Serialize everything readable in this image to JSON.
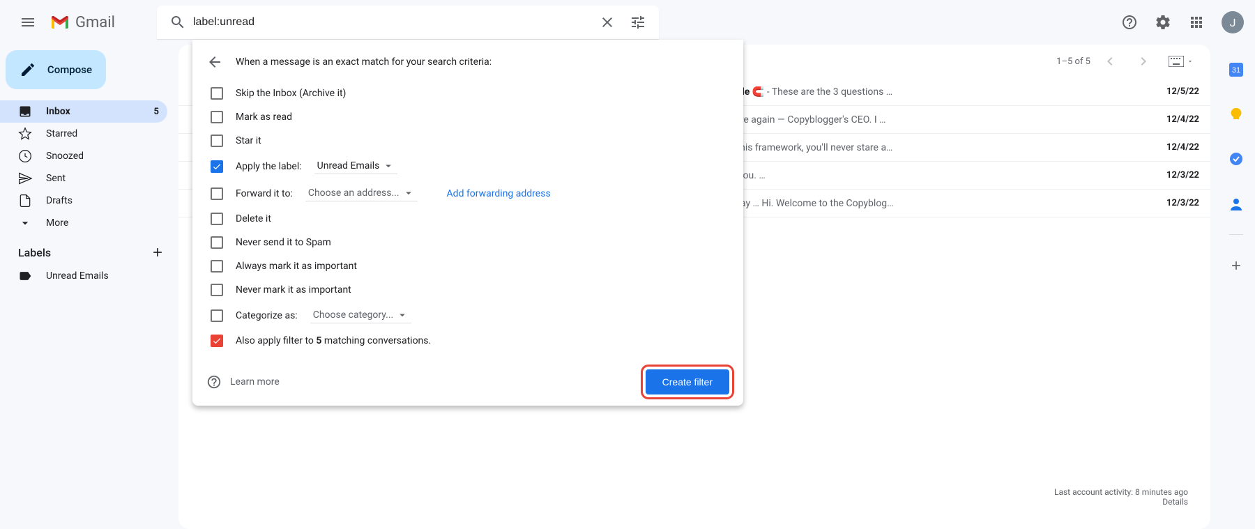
{
  "header": {
    "logo_text": "Gmail",
    "search_value": "label:unread",
    "avatar_letter": "J"
  },
  "sidebar": {
    "compose": "Compose",
    "items": [
      {
        "label": "Inbox",
        "count": "5"
      },
      {
        "label": "Starred"
      },
      {
        "label": "Snoozed"
      },
      {
        "label": "Sent"
      },
      {
        "label": "Drafts"
      },
      {
        "label": "More"
      }
    ],
    "labels_header": "Labels",
    "user_labels": [
      {
        "label": "Unread Emails"
      }
    ]
  },
  "toolbar": {
    "range": "1–5 of 5"
  },
  "messages": [
    {
      "subject": "rresistible",
      "emoji": "🧲",
      "snippet": " - These are the 3 questions …",
      "date": "12/5/22"
    },
    {
      "snippet": " - Tim here again — Copyblogger's CEO. I …",
      "date": "12/4/22"
    },
    {
      "snippet": " seeing this framework, you'll never stare a…",
      "date": "12/4/22"
    },
    {
      "snippet": "We got you.                                                             …",
      "date": "12/3/22"
    },
    {
      "snippet": "oice today … Hi. Welcome to the Copyblog…",
      "date": "12/3/22"
    }
  ],
  "footer": {
    "activity": "Last account activity: 8 minutes ago",
    "details": "Details"
  },
  "filter_popup": {
    "title": "When a message is an exact match for your search criteria:",
    "opts": {
      "skip_inbox": "Skip the Inbox (Archive it)",
      "mark_read": "Mark as read",
      "star_it": "Star it",
      "apply_label": "Apply the label:",
      "apply_label_value": "Unread Emails",
      "forward_to": "Forward it to:",
      "forward_placeholder": "Choose an address...",
      "add_forwarding": "Add forwarding address",
      "delete_it": "Delete it",
      "never_spam": "Never send it to Spam",
      "always_important": "Always mark it as important",
      "never_important": "Never mark it as important",
      "categorize_as": "Categorize as:",
      "categorize_placeholder": "Choose category...",
      "also_apply_pre": "Also apply filter to ",
      "also_apply_count": "5",
      "also_apply_post": " matching conversations."
    },
    "learn_more": "Learn more",
    "create_filter": "Create filter"
  }
}
